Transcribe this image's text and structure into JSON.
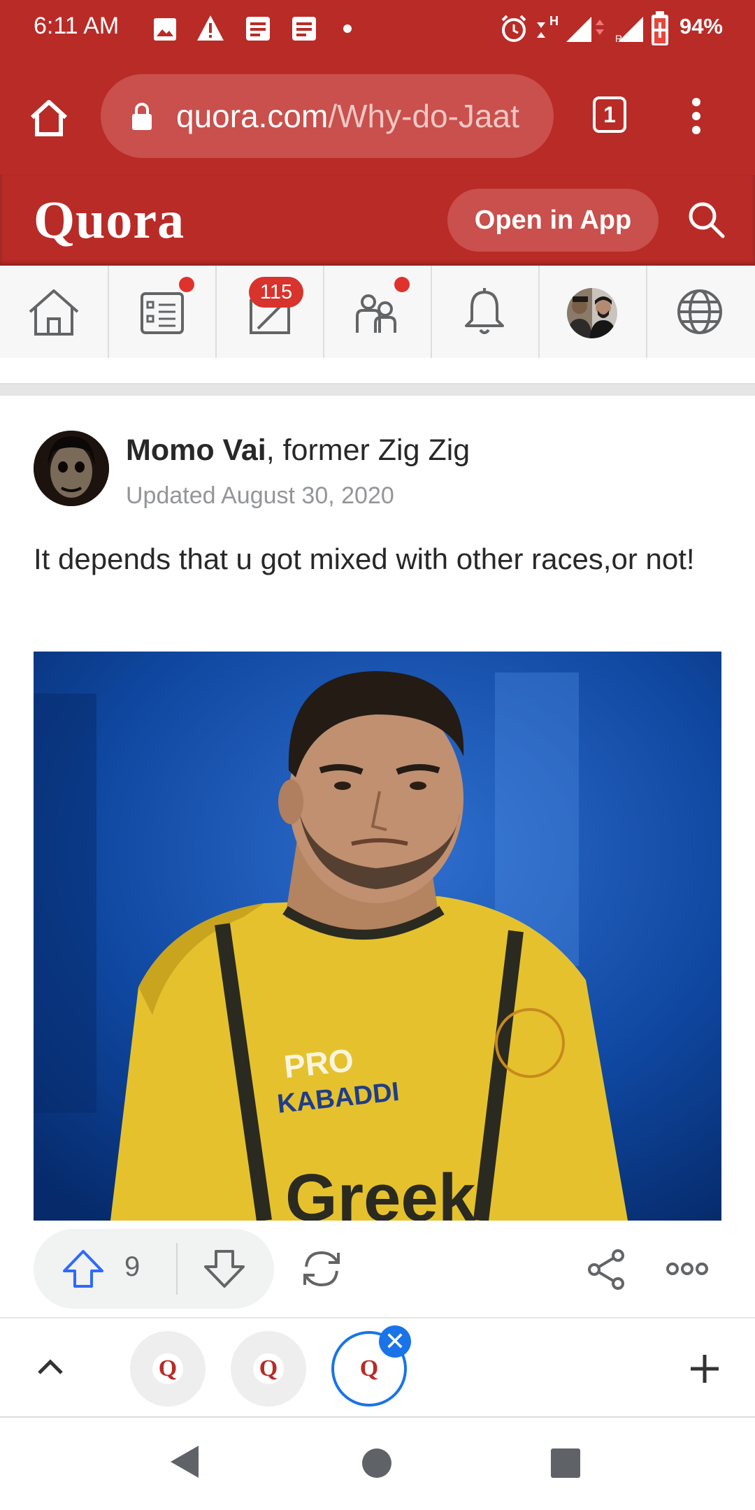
{
  "status_bar": {
    "time": "6:11 AM",
    "battery": "94%",
    "icons": [
      "image-icon",
      "warning-icon",
      "news-icon",
      "news-icon",
      "dot-icon",
      "alarm-icon",
      "data-arrows-icon",
      "signal-icon",
      "signal-icon",
      "battery-icon"
    ]
  },
  "browser": {
    "url_domain": "quora.com",
    "url_path": "/Why-do-Jaat",
    "tab_count": "1"
  },
  "quora": {
    "logo": "Quora",
    "open_in_app": "Open in App",
    "notification_count": "115"
  },
  "answer": {
    "author_name": "Momo Vai",
    "author_credential": ", former Zig Zig",
    "updated": "Updated August 30, 2020",
    "text": "It depends that u got mixed with other races,or not!",
    "upvotes": "9"
  },
  "tabs": {
    "letter": "Q",
    "close": "✕"
  },
  "colors": {
    "brand_red": "#b92b27",
    "link_blue": "#1a73e8"
  }
}
